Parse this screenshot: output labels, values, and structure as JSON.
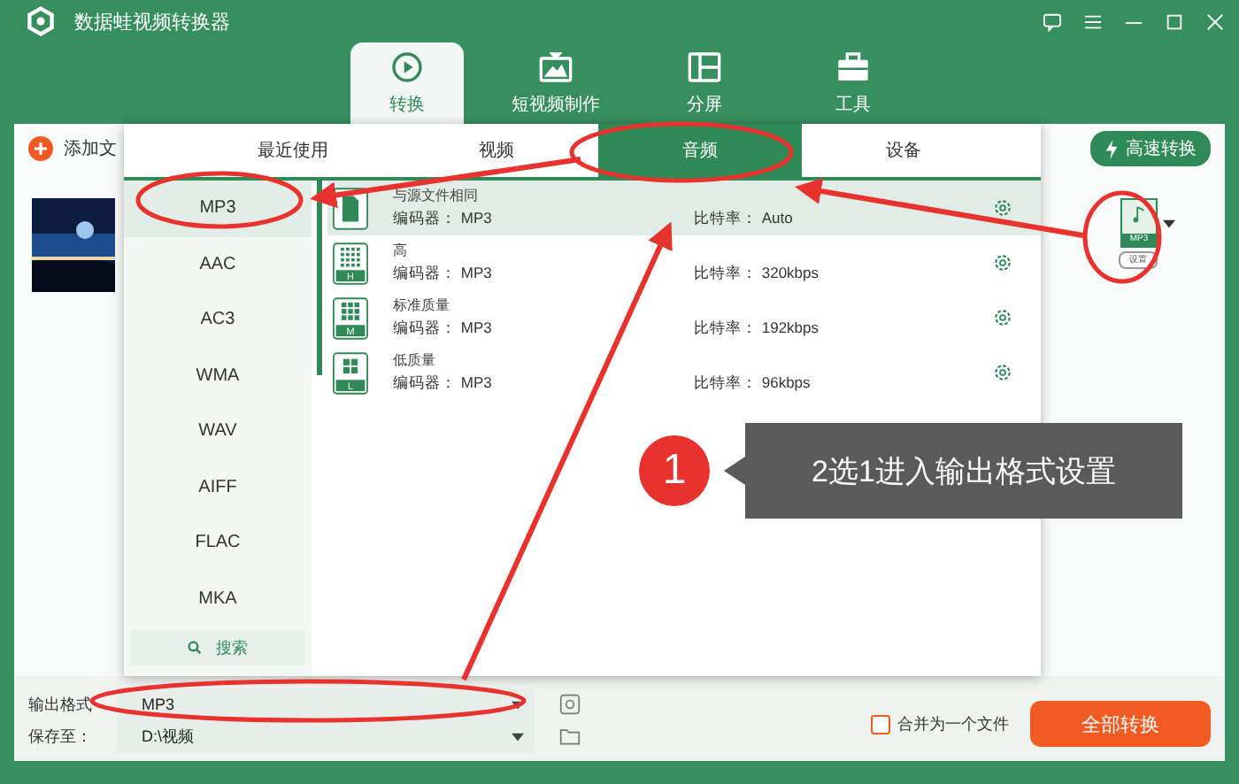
{
  "window": {
    "title": "数据蛙视频转换器"
  },
  "nav_tabs": [
    {
      "label": "转换",
      "kind": "convert",
      "selected": true
    },
    {
      "label": "短视频制作",
      "kind": "tv",
      "selected": false
    },
    {
      "label": "分屏",
      "kind": "split",
      "selected": false
    },
    {
      "label": "工具",
      "kind": "toolbox",
      "selected": false
    }
  ],
  "toolbar": {
    "add_file": "添加文",
    "fast_convert": "高速转换"
  },
  "file_item": {
    "format_badge": "MP3",
    "settings_button": "设置"
  },
  "format_popup": {
    "tabs": [
      {
        "label": "最近使用",
        "selected": false
      },
      {
        "label": "视频",
        "selected": false
      },
      {
        "label": "音频",
        "selected": true
      },
      {
        "label": "设备",
        "selected": false
      }
    ],
    "formats": [
      {
        "label": "MP3",
        "selected": true
      },
      {
        "label": "AAC",
        "selected": false
      },
      {
        "label": "AC3",
        "selected": false
      },
      {
        "label": "WMA",
        "selected": false
      },
      {
        "label": "WAV",
        "selected": false
      },
      {
        "label": "AIFF",
        "selected": false
      },
      {
        "label": "FLAC",
        "selected": false
      },
      {
        "label": "MKA",
        "selected": false
      }
    ],
    "search": "搜索",
    "presets": [
      {
        "title": "与源文件相同",
        "encoder_label": "编码器：",
        "encoder": "MP3",
        "bitrate_label": "比特率：",
        "bitrate": "Auto",
        "selected": true
      },
      {
        "title": "高",
        "badge": "H",
        "encoder_label": "编码器：",
        "encoder": "MP3",
        "bitrate_label": "比特率：",
        "bitrate": "320kbps",
        "selected": false
      },
      {
        "title": "标准质量",
        "badge": "M",
        "encoder_label": "编码器：",
        "encoder": "MP3",
        "bitrate_label": "比特率：",
        "bitrate": "192kbps",
        "selected": false
      },
      {
        "title": "低质量",
        "badge": "L",
        "encoder_label": "编码器：",
        "encoder": "MP3",
        "bitrate_label": "比特率：",
        "bitrate": "96kbps",
        "selected": false
      }
    ]
  },
  "bottom_bar": {
    "output_format_label": "输出格式",
    "output_format": "MP3",
    "save_to_label": "保存至：",
    "save_to": "D:\\视频",
    "merge": {
      "label": "合并为一个文件",
      "checked": false
    },
    "convert_all": "全部转换"
  },
  "annotation": {
    "step_number": "1",
    "callout": "2选1进入输出格式设置"
  }
}
